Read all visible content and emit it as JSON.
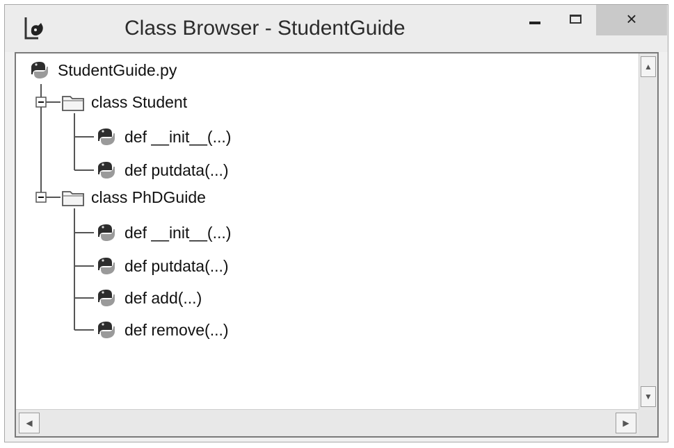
{
  "window": {
    "title": "Class Browser - StudentGuide",
    "controls": {
      "minimize": "minimize",
      "maximize": "maximize",
      "close": "×"
    }
  },
  "tree": {
    "root": "StudentGuide.py",
    "classes": [
      {
        "label": "class Student",
        "methods": [
          "def __init__(...)",
          "def putdata(...)"
        ]
      },
      {
        "label": "class PhDGuide",
        "methods": [
          "def __init__(...)",
          "def putdata(...)",
          "def add(...)",
          "def remove(...)"
        ]
      }
    ]
  },
  "scrollbars": {
    "up": "▲",
    "down": "▼",
    "left": "◀",
    "right": "▶"
  },
  "icons": {
    "app": "idle-icon",
    "module": "python-icon",
    "class": "folder-icon",
    "method": "python-icon",
    "expander": "minus-box-icon"
  }
}
